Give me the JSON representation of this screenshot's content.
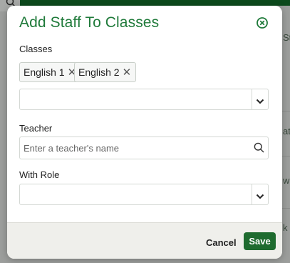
{
  "background": {
    "fragments": [
      "Sta",
      "at",
      "w",
      "k"
    ]
  },
  "modal": {
    "title": "Add Staff To Classes",
    "classes": {
      "label": "Classes",
      "chips": [
        "English 1",
        "English 2"
      ],
      "value": ""
    },
    "teacher": {
      "label": "Teacher",
      "placeholder": "Enter a teacher's name",
      "value": ""
    },
    "role": {
      "label": "With Role",
      "value": ""
    },
    "footer": {
      "cancel_label": "Cancel",
      "save_label": "Save"
    }
  },
  "colors": {
    "title": "#1f7a3a",
    "save_button": "#1e6b2f",
    "top_bar": "#0c4a1c"
  },
  "icons": [
    "search-icon",
    "close-circle-icon",
    "chevron-down-icon",
    "remove-chip-icon"
  ]
}
